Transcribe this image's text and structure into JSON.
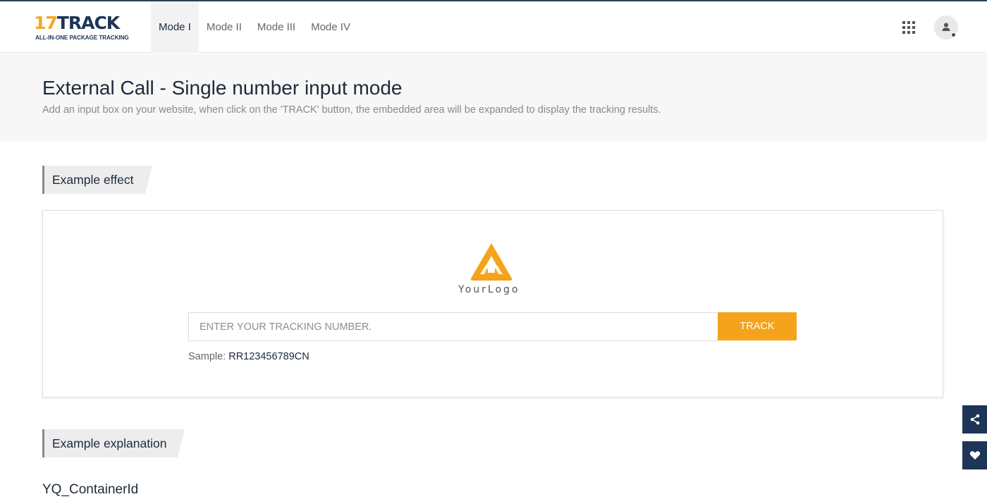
{
  "header": {
    "logo": {
      "number": "17",
      "word": "TRACK",
      "tagline": "ALL-IN-ONE PACKAGE TRACKING"
    },
    "nav": [
      {
        "label": "Mode I",
        "active": true
      },
      {
        "label": "Mode II",
        "active": false
      },
      {
        "label": "Mode III",
        "active": false
      },
      {
        "label": "Mode IV",
        "active": false
      }
    ],
    "icons": {
      "apps": "apps-grid-icon",
      "account": "user-avatar-icon"
    }
  },
  "banner": {
    "title": "External Call - Single number input mode",
    "description": "Add an input box on your website, when click on the 'TRACK' button, the embedded area will be expanded to display the tracking results."
  },
  "sections": {
    "effect_label": "Example effect",
    "explanation_label": "Example explanation"
  },
  "example": {
    "logo_text": "YourLogo",
    "input_placeholder": "ENTER YOUR TRACKING NUMBER.",
    "input_value": "",
    "button_label": "TRACK",
    "sample_label": "Sample:",
    "sample_value": "RR123456789CN"
  },
  "explanation": {
    "container_id": "YQ_ContainerId"
  },
  "side_buttons": [
    {
      "icon": "share-icon"
    },
    {
      "icon": "heart-icon"
    }
  ],
  "colors": {
    "brand_orange": "#f5a623",
    "brand_navy": "#1d3557",
    "track_button": "#f5a31a"
  }
}
